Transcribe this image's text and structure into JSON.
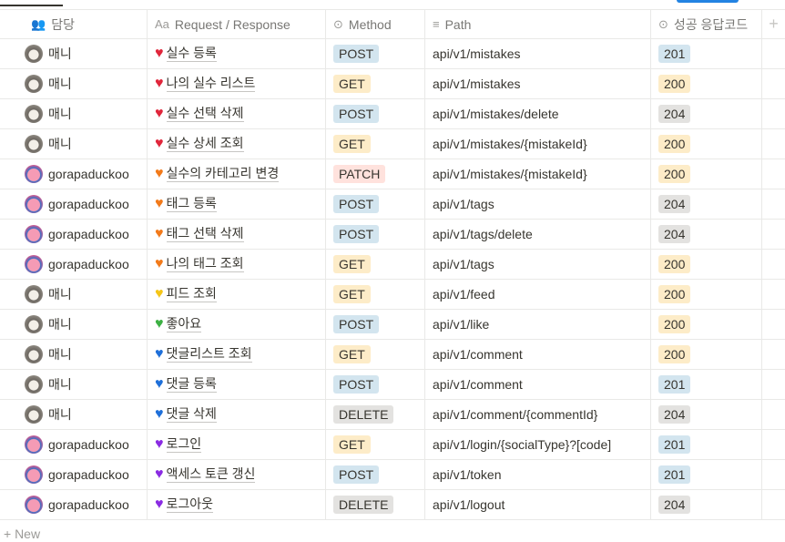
{
  "columns": [
    {
      "label": "담당",
      "icon": "people-icon"
    },
    {
      "label": "Request / Response",
      "icon": "text-aa-icon"
    },
    {
      "label": "Method",
      "icon": "select-icon"
    },
    {
      "label": "Path",
      "icon": "lines-icon"
    },
    {
      "label": "성공 응답코드",
      "icon": "select-icon"
    },
    {
      "label": "+",
      "icon": "plus-icon"
    }
  ],
  "colors": {
    "POST": "#d3e5ef",
    "GET": "#fdecc8",
    "PATCH": "#ffe2dd",
    "DELETE": "#e3e2e0",
    "201": "#d3e5ef",
    "200": "#fdecc8",
    "204": "#e3e2e0",
    "red": "#e0263b",
    "orange": "#f27a1a",
    "yellow": "#f5c518",
    "green": "#3cb043",
    "blue": "#1e6fd9",
    "purple": "#8a2be2"
  },
  "rows": [
    {
      "owner": "매니",
      "avatar": "dog",
      "heart": "red",
      "title": "실수 등록",
      "method": "POST",
      "path": "api/v1/mistakes",
      "code": "201"
    },
    {
      "owner": "매니",
      "avatar": "dog",
      "heart": "red",
      "title": "나의 실수 리스트 ",
      "method": "GET",
      "path": "api/v1/mistakes",
      "code": "200"
    },
    {
      "owner": "매니",
      "avatar": "dog",
      "heart": "red",
      "title": "실수 선택 삭제",
      "method": "POST",
      "path": "api/v1/mistakes/delete",
      "code": "204"
    },
    {
      "owner": "매니",
      "avatar": "dog",
      "heart": "red",
      "title": "실수 상세 조회",
      "method": "GET",
      "path": "api/v1/mistakes/{mistakeId}",
      "code": "200"
    },
    {
      "owner": "gorapaduckoo",
      "avatar": "kirby",
      "heart": "orange",
      "title": "실수의 카테고리 변경",
      "method": "PATCH",
      "path": "api/v1/mistakes/{mistakeId}",
      "code": "200"
    },
    {
      "owner": "gorapaduckoo",
      "avatar": "kirby",
      "heart": "orange",
      "title": "태그 등록",
      "method": "POST",
      "path": "api/v1/tags",
      "code": "204"
    },
    {
      "owner": "gorapaduckoo",
      "avatar": "kirby",
      "heart": "orange",
      "title": "태그 선택 삭제",
      "method": "POST",
      "path": "api/v1/tags/delete",
      "code": "204"
    },
    {
      "owner": "gorapaduckoo",
      "avatar": "kirby",
      "heart": "orange",
      "title": "나의 태그 조회",
      "method": "GET",
      "path": "api/v1/tags",
      "code": "200"
    },
    {
      "owner": "매니",
      "avatar": "dog",
      "heart": "yellow",
      "title": "피드 조회",
      "method": "GET",
      "path": "api/v1/feed",
      "code": "200"
    },
    {
      "owner": "매니",
      "avatar": "dog",
      "heart": "green",
      "title": "좋아요",
      "method": "POST",
      "path": "api/v1/like",
      "code": "200"
    },
    {
      "owner": "매니",
      "avatar": "dog",
      "heart": "blue",
      "title": "댓글리스트 조회",
      "method": "GET",
      "path": "api/v1/comment",
      "code": "200"
    },
    {
      "owner": "매니",
      "avatar": "dog",
      "heart": "blue",
      "title": "댓글 등록",
      "method": "POST",
      "path": "api/v1/comment",
      "code": "201"
    },
    {
      "owner": "매니",
      "avatar": "dog",
      "heart": "blue",
      "title": "댓글 삭제",
      "method": "DELETE",
      "path": "api/v1/comment/{commentId}",
      "code": "204"
    },
    {
      "owner": "gorapaduckoo",
      "avatar": "kirby",
      "heart": "purple",
      "title": "로그인",
      "method": "GET",
      "path": "api/v1/login/{socialType}?[code]",
      "code": "201"
    },
    {
      "owner": "gorapaduckoo",
      "avatar": "kirby",
      "heart": "purple",
      "title": "액세스 토큰 갱신",
      "method": "POST",
      "path": "api/v1/token",
      "code": "201"
    },
    {
      "owner": "gorapaduckoo",
      "avatar": "kirby",
      "heart": "purple",
      "title": "로그아웃",
      "method": "DELETE",
      "path": "api/v1/logout",
      "code": "204"
    }
  ],
  "new_label": "+ New"
}
